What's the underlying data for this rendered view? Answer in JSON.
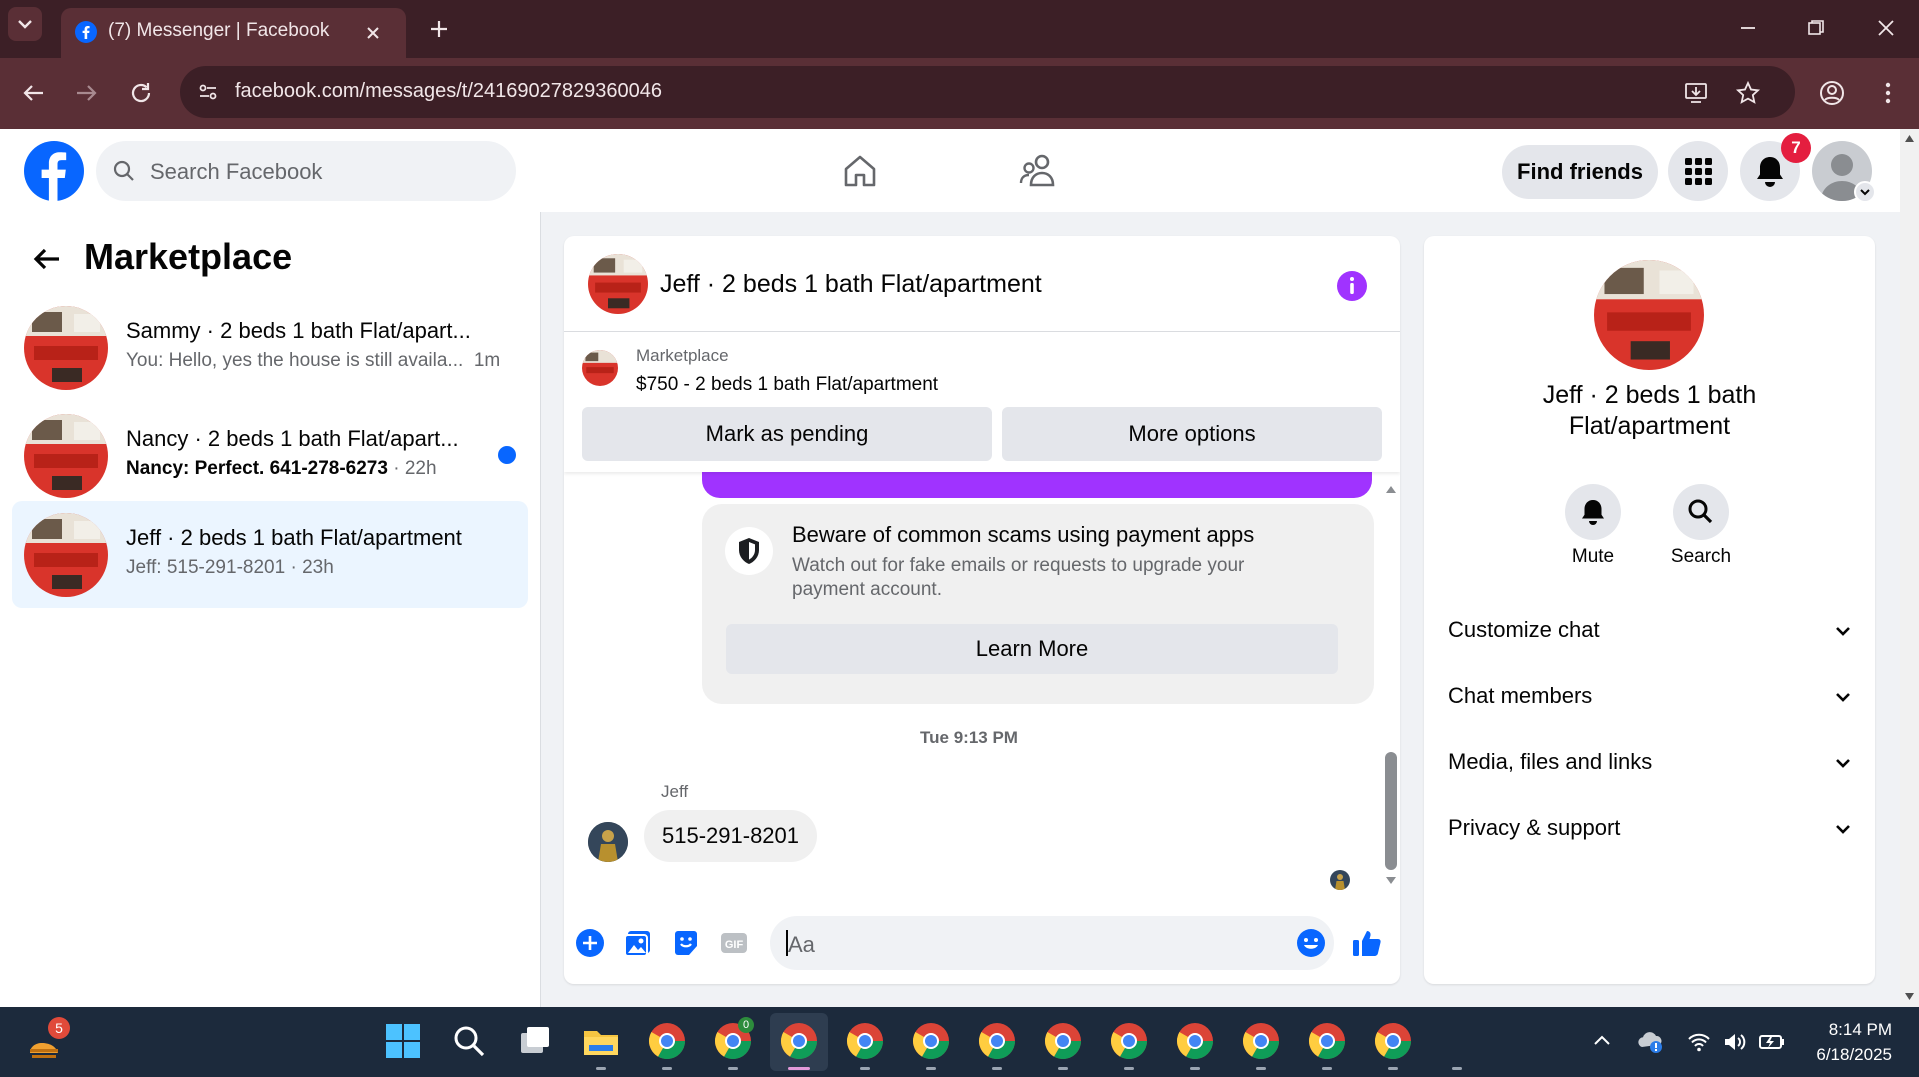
{
  "browser": {
    "tab_title": "(7) Messenger | Facebook",
    "url": "facebook.com/messages/t/24169027829360046"
  },
  "header": {
    "search_placeholder": "Search Facebook",
    "find_friends_label": "Find friends",
    "notification_count": "7"
  },
  "sidebar": {
    "title": "Marketplace",
    "conversations": [
      {
        "name": "Sammy · 2 beds 1 bath Flat/apart...",
        "preview": "You: Hello, yes the house is still availa...",
        "time": "1m",
        "unread": false,
        "active": false
      },
      {
        "name": "Nancy · 2 beds 1 bath Flat/apart...",
        "preview": "Nancy: Perfect. 641-278-6273",
        "time": "22h",
        "unread": true,
        "active": false
      },
      {
        "name": "Jeff · 2 beds 1 bath Flat/apartment",
        "preview": "Jeff: 515-291-8201",
        "time": "23h",
        "unread": false,
        "active": true
      }
    ]
  },
  "chat": {
    "title": "Jeff · 2 beds 1 bath Flat/apartment",
    "marketplace_label": "Marketplace",
    "listing": "$750 - 2 beds 1 bath Flat/apartment",
    "mark_pending_label": "Mark as pending",
    "more_options_label": "More options",
    "scam_title": "Beware of common scams using payment apps",
    "scam_body": "Watch out for fake emails or requests to upgrade your payment account.",
    "learn_more_label": "Learn More",
    "timestamp": "Tue 9:13 PM",
    "sender": "Jeff",
    "message": "515-291-8201",
    "composer_placeholder": "Aa"
  },
  "info_panel": {
    "name": "Jeff · 2 beds 1 bath Flat/apartment",
    "mute_label": "Mute",
    "search_label": "Search",
    "sections": [
      "Customize chat",
      "Chat members",
      "Media, files and links",
      "Privacy & support"
    ]
  },
  "taskbar": {
    "weather_badge": "5",
    "chrome_badge": "0",
    "time": "8:14 PM",
    "date": "6/18/2025"
  },
  "colors": {
    "fb_blue": "#0866ff",
    "messenger_purple": "#a033ff",
    "chrome_dark": "#3c1f26",
    "chrome_mid": "#5a2f36"
  }
}
